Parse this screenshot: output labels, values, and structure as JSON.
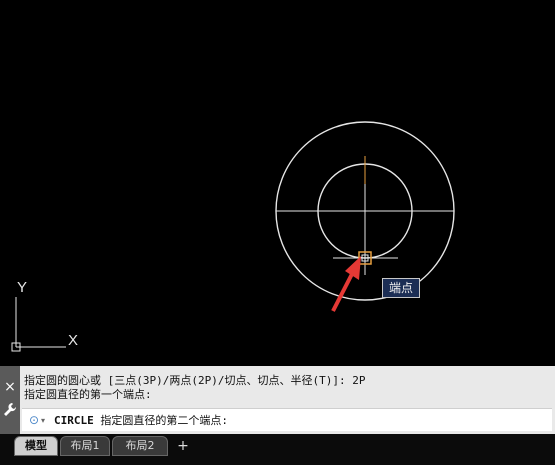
{
  "osnap_tooltip": "端点",
  "ucs": {
    "y_label": "Y",
    "x_label": "X"
  },
  "command": {
    "history_line1": "指定圆的圆心或 [三点(3P)/两点(2P)/切点、切点、半径(T)]: 2P",
    "history_line2": "指定圆直径的第一个端点:",
    "input_command": "CIRCLE",
    "input_prompt": " 指定圆直径的第二个端点:",
    "close_icon": "×",
    "settings_icon": "wrench-icon"
  },
  "tabs": [
    {
      "label": "模型",
      "active": true
    },
    {
      "label": "布局1",
      "active": false
    },
    {
      "label": "布局2",
      "active": false
    }
  ],
  "add_tab": "+",
  "colors": {
    "background": "#000000",
    "geometry": "#e6e6e6",
    "crosshair_center": "#e8a040",
    "arrow": "#e53935",
    "osnap_marker": "#e8a040"
  }
}
